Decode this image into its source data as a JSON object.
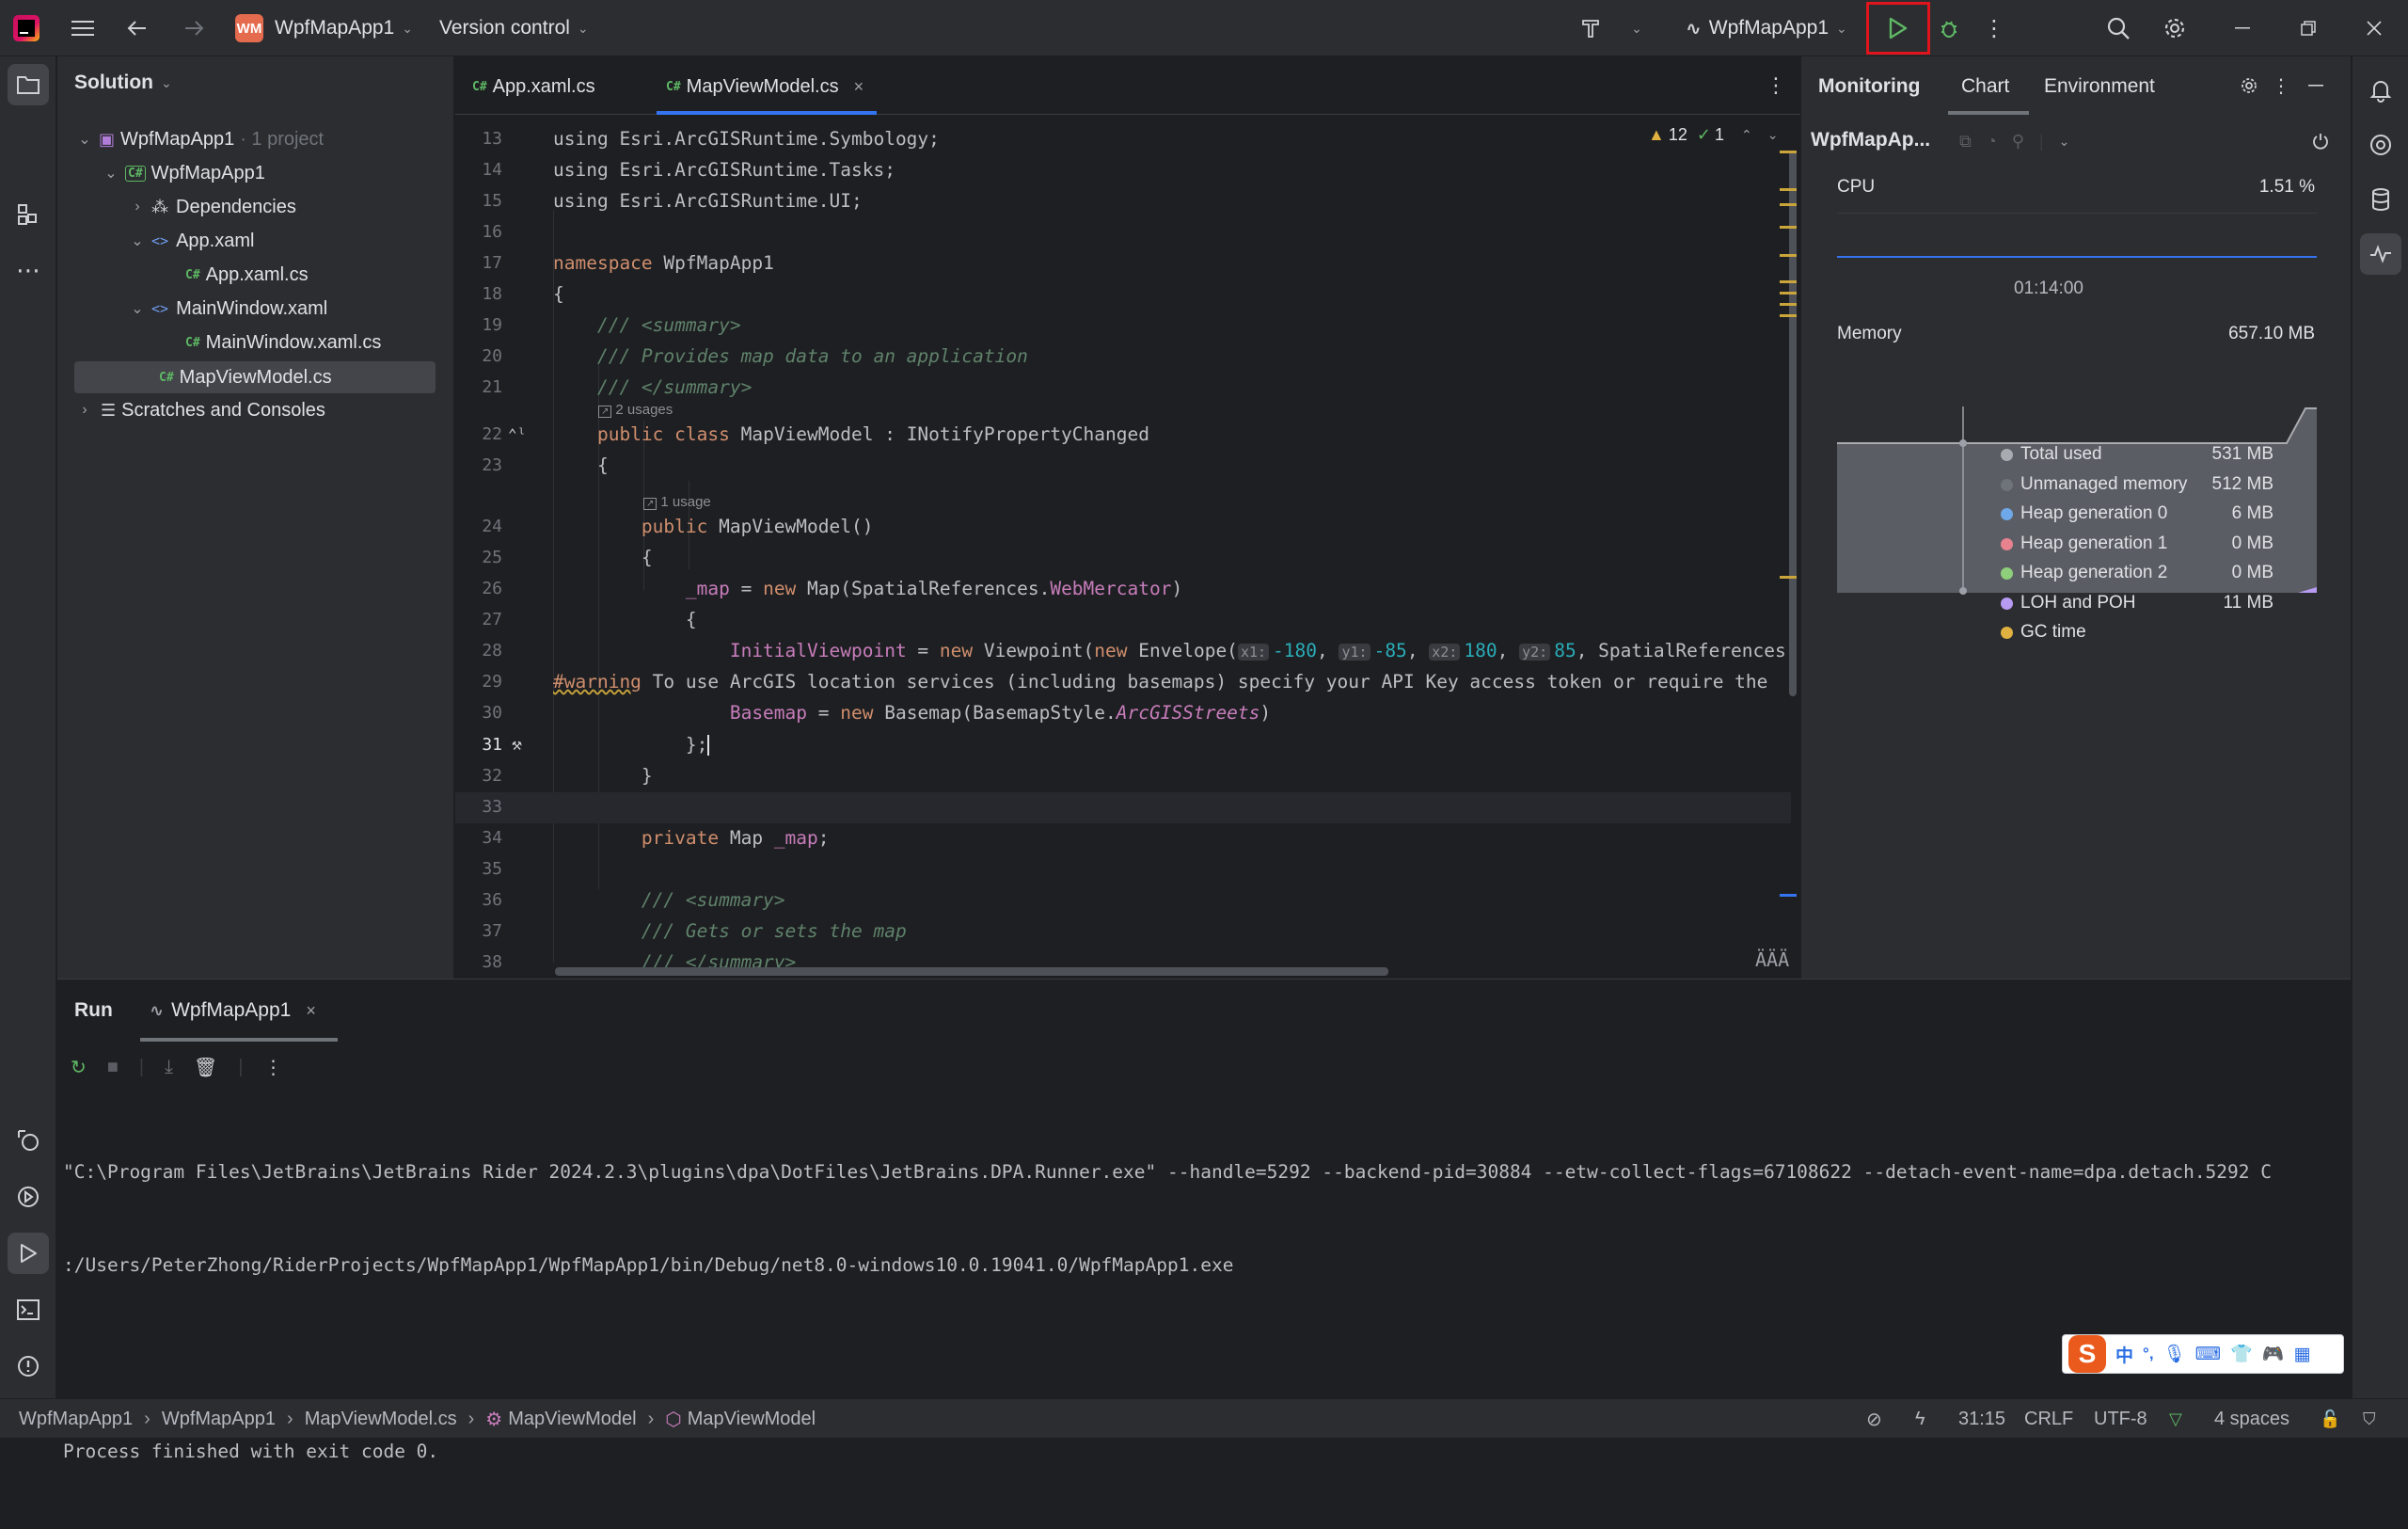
{
  "topbar": {
    "project_badge": "WM",
    "project_name": "WpfMapApp1",
    "version_control": "Version control",
    "run_config": "WpfMapApp1"
  },
  "solution": {
    "title": "Solution",
    "items": [
      {
        "label": "WpfMapApp1",
        "suffix": "· 1 project"
      },
      {
        "label": "WpfMapApp1"
      },
      {
        "label": "Dependencies"
      },
      {
        "label": "App.xaml"
      },
      {
        "label": "App.xaml.cs"
      },
      {
        "label": "MainWindow.xaml"
      },
      {
        "label": "MainWindow.xaml.cs"
      },
      {
        "label": "MapViewModel.cs"
      },
      {
        "label": "Scratches and Consoles"
      }
    ]
  },
  "editor": {
    "tabs": [
      {
        "label": "App.xaml.cs"
      },
      {
        "label": "MapViewModel.cs"
      }
    ],
    "inspections": {
      "warnings": "12",
      "ok": "1"
    },
    "line_numbers": [
      "13",
      "14",
      "15",
      "16",
      "17",
      "18",
      "19",
      "20",
      "21",
      "22",
      "23",
      "24",
      "25",
      "26",
      "27",
      "28",
      "29",
      "30",
      "31",
      "32",
      "33",
      "34",
      "35",
      "36",
      "37",
      "38"
    ],
    "usages": [
      "2 usages",
      "1 usage"
    ],
    "code": {
      "l13": "using Esri.ArcGISRuntime.Symbology;",
      "l14": "using Esri.ArcGISRuntime.Tasks;",
      "l15": "using Esri.ArcGISRuntime.UI;",
      "l17a": "namespace ",
      "l17b": "WpfMapApp1",
      "l18": "{",
      "l19": "    /// <summary>",
      "l20": "    /// Provides map data to an application",
      "l21": "    /// </summary>",
      "l22a": "    public class ",
      "l22b": "MapViewModel : INotifyPropertyChanged",
      "l23": "    {",
      "l24a": "        public ",
      "l24b": "MapViewModel()",
      "l25": "        {",
      "l26a": "            _map",
      "l26b": " = ",
      "l26c": "new ",
      "l26d": "Map(SpatialReferences.",
      "l26e": "WebMercator",
      "l26f": ")",
      "l27": "            {",
      "l28a": "                InitialViewpoint",
      "l28b": " = ",
      "l28c": "new ",
      "l28d": "Viewpoint(",
      "l28e": "new ",
      "l28f": "Envelope(",
      "l28h1": "x1:",
      "l28v1": "-180",
      "l28h2": "y1:",
      "l28v2": "-85",
      "l28h3": "x2:",
      "l28v3": "180",
      "l28h4": "y2:",
      "l28v4": "85",
      "l28g": ", SpatialReferences",
      "l29a": "#warning",
      "l29b": " To use ArcGIS location services (including basemaps) specify your API Key access token or require the",
      "l30a": "                Basemap",
      "l30b": " = ",
      "l30c": "new ",
      "l30d": "Basemap(BasemapStyle.",
      "l30e": "ArcGISStreets",
      "l30f": ")",
      "l31": "            };",
      "l32": "        }",
      "l34a": "        private ",
      "l34b": "Map ",
      "l34c": "_map",
      "l34d": ";",
      "l36": "        /// <summary>",
      "l37": "        /// Gets or sets the map",
      "l38": "        /// </summary>"
    }
  },
  "monitoring": {
    "tabs": [
      "Monitoring",
      "Chart",
      "Environment"
    ],
    "process": "WpfMapAp...",
    "cpu_label": "CPU",
    "cpu_value": "1.51 %",
    "time": "01:14:00",
    "memory_label": "Memory",
    "memory_value": "657.10 MB",
    "legend": [
      {
        "label": "Total used",
        "value": "531 MB",
        "color": "#a8abb0"
      },
      {
        "label": "Unmanaged memory",
        "value": "512 MB",
        "color": "#6f737a"
      },
      {
        "label": "Heap generation 0",
        "value": "6 MB",
        "color": "#6fa8e8"
      },
      {
        "label": "Heap generation 1",
        "value": "0 MB",
        "color": "#e8828f"
      },
      {
        "label": "Heap generation 2",
        "value": "0 MB",
        "color": "#8fce7a"
      },
      {
        "label": "LOH and POH",
        "value": "11 MB",
        "color": "#b79bf2"
      },
      {
        "label": "GC time",
        "value": "",
        "color": "#e0b040"
      }
    ]
  },
  "run": {
    "title": "Run",
    "tab": "WpfMapApp1",
    "output": [
      "\"C:\\Program Files\\JetBrains\\JetBrains Rider 2024.2.3\\plugins\\dpa\\DotFiles\\JetBrains.DPA.Runner.exe\" --handle=5292 --backend-pid=30884 --etw-collect-flags=67108622 --detach-event-name=dpa.detach.5292 C",
      ":/Users/PeterZhong/RiderProjects/WpfMapApp1/WpfMapApp1/bin/Debug/net8.0-windows10.0.19041.0/WpfMapApp1.exe",
      "",
      "Process finished with exit code 0."
    ]
  },
  "statusbar": {
    "crumbs": [
      "WpfMapApp1",
      "WpfMapApp1",
      "MapViewModel.cs",
      "MapViewModel",
      "MapViewModel"
    ],
    "position": "31:15",
    "line_ending": "CRLF",
    "encoding": "UTF-8",
    "indent": "4 spaces"
  },
  "ime": {
    "labels": [
      "中",
      "°,"
    ]
  }
}
